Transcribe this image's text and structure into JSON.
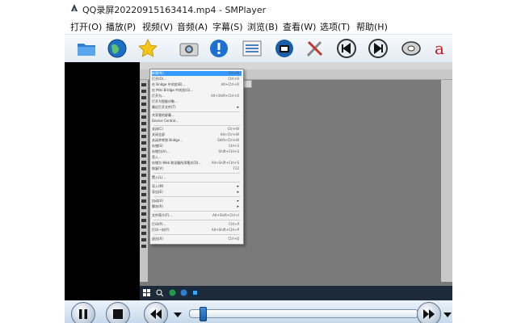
{
  "window": {
    "title": "QQ录屏20220915163414.mp4 - SMPlayer"
  },
  "menubar": {
    "items": [
      "打开(O)",
      "播放(P)",
      "视频(V)",
      "音频(A)",
      "字幕(S)",
      "浏览(B)",
      "查看(W)",
      "选项(T)",
      "帮助(H)"
    ]
  },
  "toolbar": {
    "icons": [
      "folder-icon",
      "globe-icon",
      "star-icon",
      "camera-icon",
      "info-icon",
      "playlist-icon",
      "film-icon",
      "tools-icon",
      "previous-icon",
      "next-icon",
      "disc-icon",
      "subtitle-icon"
    ]
  },
  "ps_menu": {
    "items": [
      "文件(F)",
      "编辑(E)",
      "图像(I)",
      "图层(L)",
      "文字(Y)",
      "选择(S)",
      "滤镜(T)",
      "3D(D)",
      "视图(V)",
      "窗口(W)",
      "帮助(H)"
    ]
  },
  "ps_dropdown": {
    "items": [
      {
        "label": "新建(N)...",
        "shortcut": "Ctrl+N"
      },
      {
        "label": "打开(O)...",
        "shortcut": "Ctrl+O"
      },
      {
        "label": "在 Bridge 中浏览(B)...",
        "shortcut": "Alt+Ctrl+O"
      },
      {
        "label": "在 Mini Bridge 中浏览(G)...",
        "shortcut": ""
      },
      {
        "label": "打开为...",
        "shortcut": "Alt+Shift+Ctrl+O"
      },
      {
        "label": "打开为智能对象...",
        "shortcut": ""
      },
      {
        "label": "最近打开文件(T)",
        "shortcut": ""
      },
      {
        "label": "共享我的屏幕...",
        "shortcut": ""
      },
      {
        "label": "Device Central...",
        "shortcut": ""
      },
      {
        "label": "关闭(C)",
        "shortcut": "Ctrl+W"
      },
      {
        "label": "关闭全部",
        "shortcut": "Alt+Ctrl+W"
      },
      {
        "label": "关闭并转到 Bridge...",
        "shortcut": "Shift+Ctrl+W"
      },
      {
        "label": "存储(S)",
        "shortcut": "Ctrl+S"
      },
      {
        "label": "存储为(A)...",
        "shortcut": "Shift+Ctrl+S"
      },
      {
        "label": "签入...",
        "shortcut": ""
      },
      {
        "label": "存储为 Web 和设备所用格式(D)...",
        "shortcut": "Alt+Shift+Ctrl+S"
      },
      {
        "label": "恢复(V)",
        "shortcut": "F12"
      },
      {
        "label": "置入(L)...",
        "shortcut": ""
      },
      {
        "label": "导入(M)",
        "shortcut": ""
      },
      {
        "label": "导出(E)",
        "shortcut": ""
      },
      {
        "label": "自动(U)",
        "shortcut": ""
      },
      {
        "label": "脚本(R)",
        "shortcut": ""
      },
      {
        "label": "文件简介(F)...",
        "shortcut": "Alt+Shift+Ctrl+I"
      },
      {
        "label": "打印(P)...",
        "shortcut": "Ctrl+P"
      },
      {
        "label": "打印一份(Y)",
        "shortcut": "Alt+Shift+Ctrl+P"
      },
      {
        "label": "退出(X)",
        "shortcut": "Ctrl+Q"
      }
    ]
  },
  "controls": {
    "seek_progress": 0.05
  }
}
